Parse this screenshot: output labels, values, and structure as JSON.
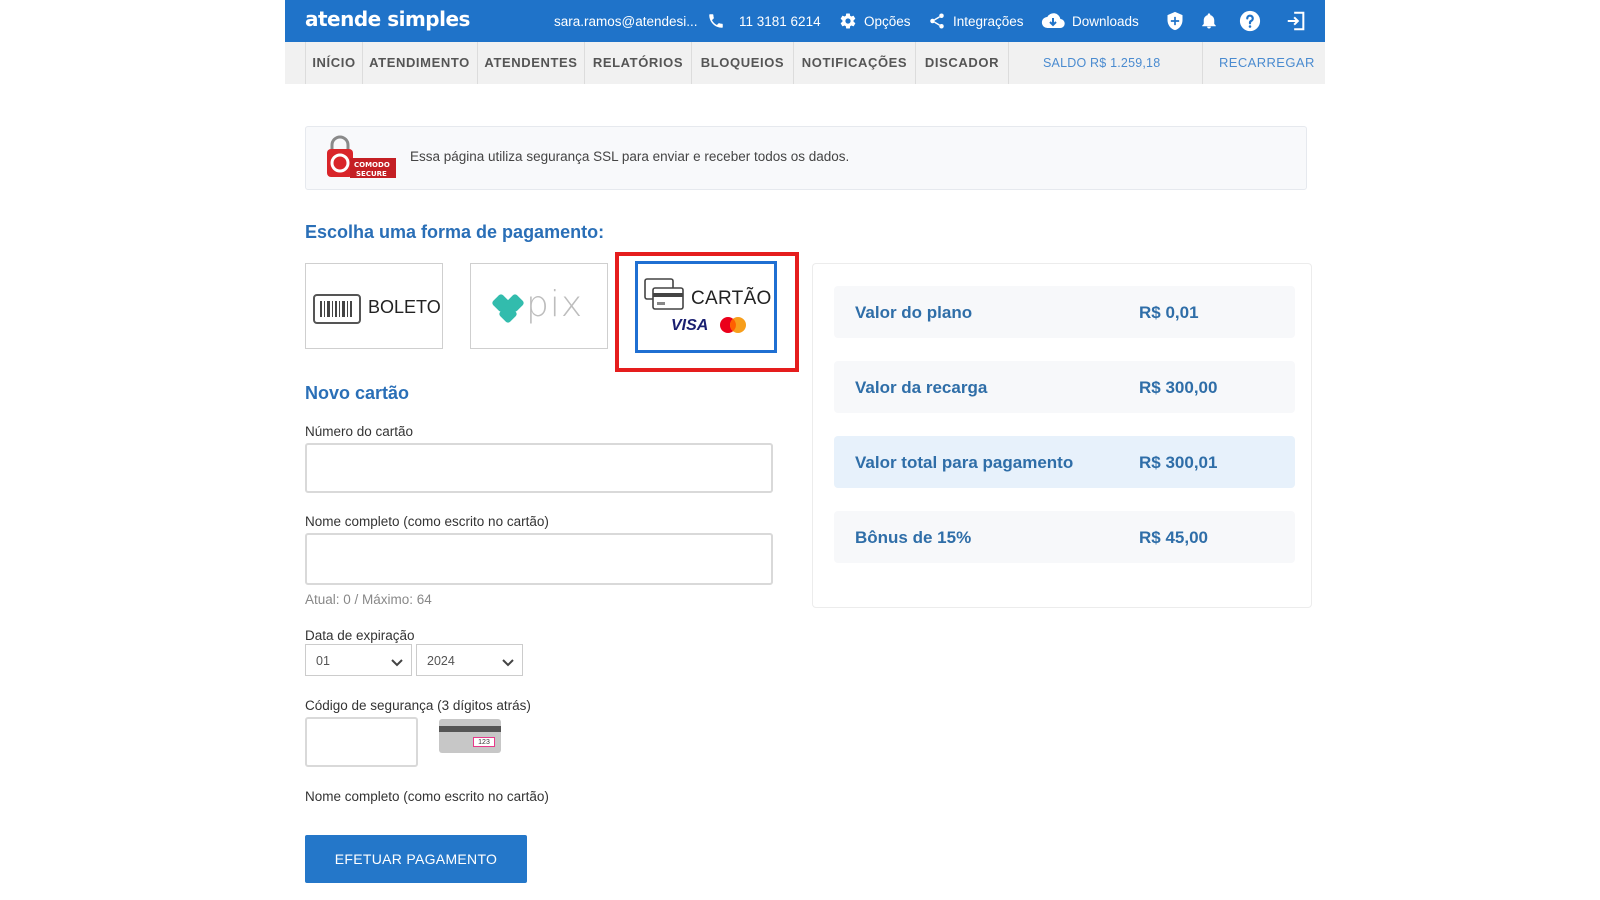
{
  "app": {
    "logo": "atende simples"
  },
  "topbar": {
    "user_email": "sara.ramos@atendesi...",
    "phone": "11 3181 6214",
    "options": "Opções",
    "integrations": "Integrações",
    "downloads": "Downloads"
  },
  "nav": {
    "items": [
      "INÍCIO",
      "ATENDIMENTO",
      "ATENDENTES",
      "RELATÓRIOS",
      "BLOQUEIOS",
      "NOTIFICAÇÕES",
      "DISCADOR"
    ],
    "saldo": "SALDO R$ 1.259,18",
    "recarregar": "RECARREGAR"
  },
  "ssl": {
    "badge_line1": "COMODO",
    "badge_line2": "SECURE",
    "message": "Essa página utiliza segurança SSL para enviar e receber todos os dados."
  },
  "payment": {
    "title": "Escolha uma forma de pagamento:",
    "options": [
      "BOLETO",
      "pix",
      "CARTÃO"
    ],
    "selected": "CARTÃO",
    "card_brands": [
      "VISA",
      "MasterCard"
    ]
  },
  "form": {
    "title": "Novo cartão",
    "card_number_label": "Número do cartão",
    "card_number_value": "",
    "name_label": "Nome completo (como escrito no cartão)",
    "name_value": "",
    "name_counter": "Atual: 0 / Máximo: 64",
    "expiry_label": "Data de expiração",
    "expiry_month": "01",
    "expiry_year": "2024",
    "cvv_label": "Código de segurança (3 dígitos atrás)",
    "cvv_value": "",
    "cvv_example": "123",
    "name_label_repeat": "Nome completo (como escrito no cartão)",
    "submit_label": "EFETUAR PAGAMENTO"
  },
  "summary": {
    "rows": [
      {
        "label": "Valor do plano",
        "value": "R$ 0,01"
      },
      {
        "label": "Valor da recarga",
        "value": "R$ 300,00"
      },
      {
        "label": "Valor total para pagamento",
        "value": "R$ 300,01"
      },
      {
        "label": "Bônus de 15%",
        "value": "R$ 45,00"
      }
    ]
  },
  "colors": {
    "brand_blue": "#1f73c9",
    "title_blue": "#2a6fb7",
    "highlight_red": "#e51d1d",
    "selected_border": "#1f6fd2",
    "pix_green": "#32bcad"
  }
}
